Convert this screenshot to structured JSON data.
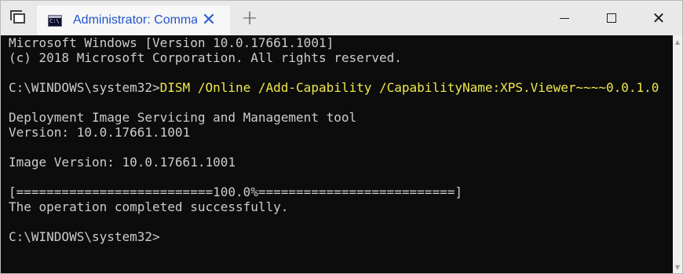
{
  "window": {
    "tab_title": "Administrator: Command Prompt",
    "tab_close_glyph": "✕",
    "new_tab_glyph": "+",
    "minimize_icon": "minimize-icon",
    "maximize_icon": "maximize-icon",
    "close_glyph": "✕"
  },
  "console": {
    "lines": [
      "Microsoft Windows [Version 10.0.17661.1001]",
      "(c) 2018 Microsoft Corporation. All rights reserved.",
      "",
      "C:\\WINDOWS\\system32>",
      "",
      "Deployment Image Servicing and Management tool",
      "Version: 10.0.17661.1001",
      "",
      "Image Version: 10.0.17661.1001",
      "",
      "[==========================100.0%==========================]",
      "The operation completed successfully.",
      "",
      "C:\\WINDOWS\\system32>"
    ],
    "command": "DISM /Online /Add-Capability /CapabilityName:XPS.Viewer~~~~0.0.1.0",
    "progress_percent": 100.0
  },
  "colors": {
    "console_bg": "#0c0c0c",
    "console_text": "#cccccc",
    "command_text": "#f0e74b",
    "tab_title": "#2255cc"
  }
}
